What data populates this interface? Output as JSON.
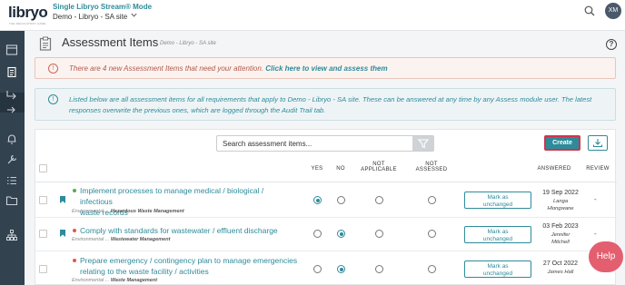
{
  "topbar": {
    "logo": "libryo",
    "logo_tagline": "THE REGULATORY GAME",
    "mode": "Single Libryo Stream® Mode",
    "site": "Demo - Libryo - SA site",
    "avatar": "XM",
    "icons": [
      "search-icon",
      "chevron-down-icon"
    ]
  },
  "sidebar": {
    "items": [
      "dashboard-icon",
      "clipboard-icon",
      "arrow-right-icon",
      "login-icon",
      "bell-icon",
      "tools-icon",
      "checklist-icon",
      "folder-icon",
      "sitemap-icon"
    ],
    "active": "clipboard-icon"
  },
  "page": {
    "title": "Assessment Items",
    "subtitle": "Demo - Libryo - SA site",
    "help": "?"
  },
  "alert": {
    "text": "There are 4 new Assessment Items that need your attention.",
    "link": "Click here to view and assess them",
    "icon": "!"
  },
  "info": {
    "text": "Listed below are all assessment items for all requirements that apply to Demo - Libryo - SA site. These can be answered at any time by any Assess module user. The latest responses overwrite the previous ones, which are logged through the Audit Trail tab.",
    "icon": "!"
  },
  "toolbar": {
    "search_placeholder": "Search assessment items...",
    "create_label": "Create"
  },
  "table": {
    "headers": {
      "yes": "YES",
      "no": "NO",
      "not_applicable_1": "NOT",
      "not_applicable_2": "APPLICABLE",
      "not_assessed_1": "NOT",
      "not_assessed_2": "ASSESSED",
      "answered": "ANSWERED",
      "review": "REVIEW"
    },
    "mark_label_1": "Mark as",
    "mark_label_2": "unchanged",
    "rows": [
      {
        "title_1": "Implement processes to manage medical / biological / infectious",
        "title_2": "waste records",
        "category": "Environmental ...",
        "subcategory": "Hazardous Waste Management",
        "status_color": "#4caf50",
        "answer": "yes",
        "date": "19 Sep 2022",
        "user_1": "Langa",
        "user_2": "Hlongwane",
        "review": "-"
      },
      {
        "title_1": "Comply with standards for wastewater / effluent discharge",
        "title_2": "",
        "category": "Environmental ...",
        "subcategory": "Wastewater Management",
        "status_color": "#e2574c",
        "answer": "no",
        "date": "03 Feb 2023",
        "user_1": "Jennifer",
        "user_2": "Mitchell",
        "review": "-"
      },
      {
        "title_1": "Prepare emergency / contingency plan to manage emergencies",
        "title_2": "relating to the waste facility / activities",
        "category": "Environmental ...",
        "subcategory": "Waste Management",
        "status_color": "#e2574c",
        "answer": "no",
        "date": "27 Oct 2022",
        "user_1": "James Hall",
        "user_2": "",
        "review": "-"
      }
    ]
  },
  "help_button": "Help",
  "colors": {
    "accent": "#2e8b9a",
    "sidebar": "#33424f",
    "alert": "#b5584a",
    "create_border": "#d2344c"
  }
}
